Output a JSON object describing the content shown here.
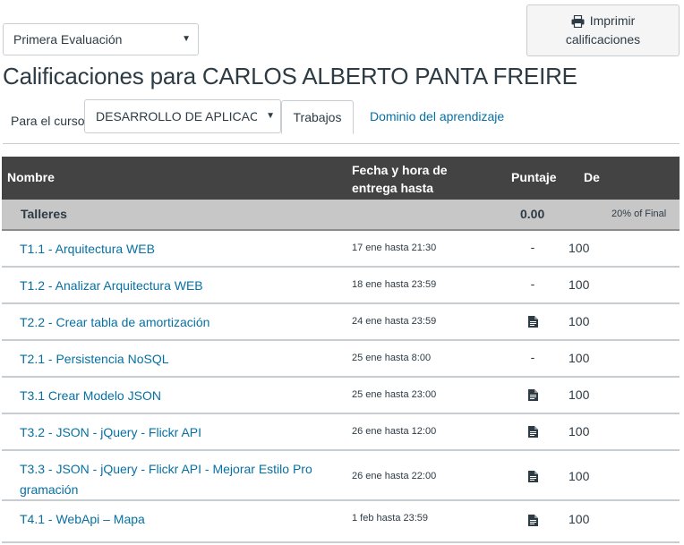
{
  "grading_period": {
    "selected": "Primera Evaluación",
    "caret_icon": "caret-down-icon"
  },
  "print_button": {
    "icon": "printer-icon",
    "label_line1": "Imprimir",
    "label_line2": "calificaciones"
  },
  "page_title": "Calificaciones para CARLOS ALBERTO PANTA FREIRE",
  "course": {
    "label": "Para el curso",
    "selected": "DESARROLLO DE APLICACIONES"
  },
  "tabs": [
    {
      "label": "Trabajos",
      "active": true
    },
    {
      "label": "Dominio del aprendizaje",
      "active": false
    }
  ],
  "table": {
    "headers": {
      "name": "Nombre",
      "due": "Fecha y hora de entrega hasta",
      "score": "Puntaje",
      "out_of": "De"
    },
    "group": {
      "name": "Talleres",
      "score": "0.00",
      "weight": "20% of Final"
    },
    "rows": [
      {
        "name": "T1.1 - Arquitectura WEB",
        "due": "17 ene hasta 21:30",
        "score": "-",
        "out_of": "100",
        "score_icon": ""
      },
      {
        "name": "T1.2 - Analizar Arquitectura WEB",
        "due": "18 ene hasta 23:59",
        "score": "-",
        "out_of": "100",
        "score_icon": ""
      },
      {
        "name": "T2.2 - Crear tabla de amortización",
        "due": "24 ene hasta 23:59",
        "score": "",
        "out_of": "100",
        "score_icon": "document-icon"
      },
      {
        "name": "T2.1 - Persistencia NoSQL",
        "due": "25 ene hasta 8:00",
        "score": "-",
        "out_of": "100",
        "score_icon": ""
      },
      {
        "name": "T3.1 Crear Modelo JSON",
        "due": "25 ene hasta 23:00",
        "score": "",
        "out_of": "100",
        "score_icon": "document-icon"
      },
      {
        "name": "T3.2 - JSON - jQuery - Flickr API",
        "due": "26 ene hasta 12:00",
        "score": "",
        "out_of": "100",
        "score_icon": "document-icon"
      },
      {
        "name": "T3.3 - JSON - jQuery - Flickr API - Mejorar Estilo Pro gramación",
        "due": "26 ene hasta 22:00",
        "score": "",
        "out_of": "100",
        "score_icon": "document-icon"
      },
      {
        "name": "T4.1 - WebApi – Mapa",
        "due": "1 feb hasta 23:59",
        "score": "",
        "out_of": "100",
        "score_icon": "document-icon"
      }
    ]
  },
  "colors": {
    "link": "#0770a3",
    "header_bg": "#434343",
    "group_bg": "#c7c7c7",
    "text": "#2d3b45"
  }
}
